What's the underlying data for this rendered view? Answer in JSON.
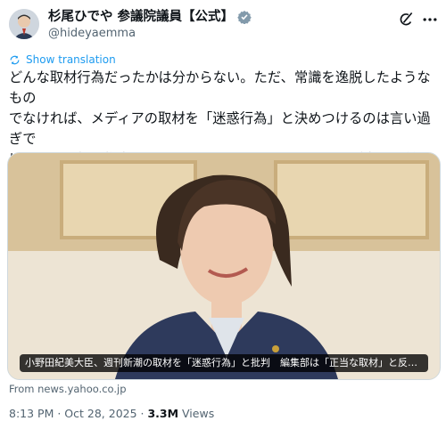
{
  "author": {
    "display_name": "杉尾ひでや 参議院議員【公式】",
    "handle": "@hideyaemma"
  },
  "icons": {
    "verified": "verified-badge-icon",
    "grok": "grok-icon",
    "more": "more-icon",
    "translate": "translate-icon"
  },
  "colors": {
    "accent": "#1d9bf0",
    "secondary_text": "#536471"
  },
  "translate_label": "Show translation",
  "tweet_text": "どんな取材行為だったかは分からない。ただ、常識を逸脱したようなもの\nでなければ、メディアの取材を「迷惑行為」と決めつけるのは言い過ぎで\nはないか。特に権力の側にいるものはチェックされるのが当たり前なの\nだ。私はこの投稿に強い違和感を覚える。",
  "card": {
    "caption": "小野田紀美大臣、週刊新潮の取材を「迷惑行為」と批判　編集部は「正当な取材」と反…",
    "source": "From news.yahoo.co.jp"
  },
  "meta": {
    "time": "8:13 PM",
    "separator1": " · ",
    "date": "Oct 28, 2025",
    "separator2": " · ",
    "views_count": "3.3M",
    "views_label": " Views"
  }
}
